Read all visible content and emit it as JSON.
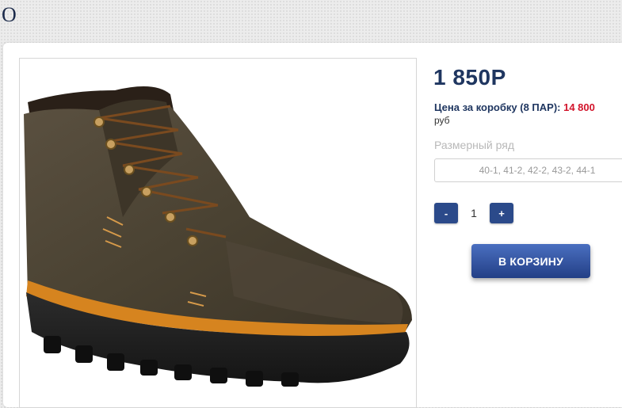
{
  "header": {
    "letter": "O"
  },
  "product": {
    "image_alt": "boot-photo",
    "price": "1 850Р",
    "box_price_label": "Цена за коробку (8 ПАР):",
    "box_price_value": "14 800",
    "box_price_unit": "руб",
    "size_label": "Размерный ряд",
    "size_value": "40-1, 41-2, 42-2, 43-2, 44-1",
    "quantity": {
      "minus_label": "-",
      "value": "1",
      "plus_label": "+"
    },
    "cart_button_label": "В КОРЗИНУ"
  },
  "colors": {
    "brand_blue": "#1f3660",
    "button_blue": "#2b4a8a",
    "price_red": "#d2142b"
  }
}
